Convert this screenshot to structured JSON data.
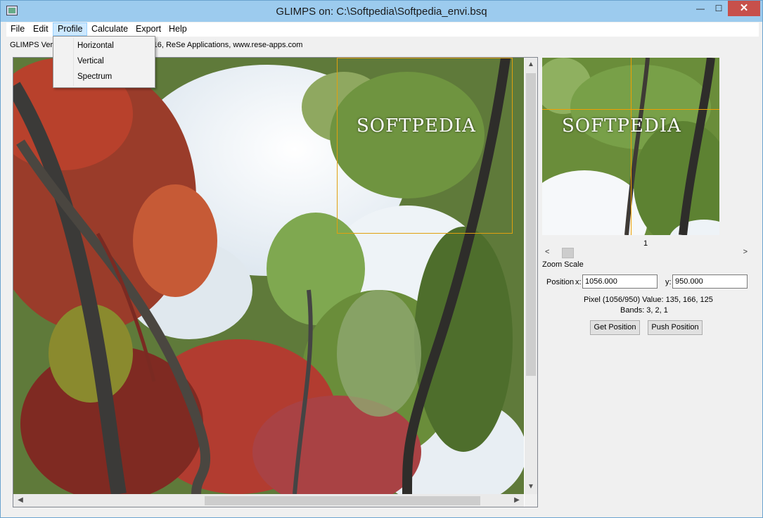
{
  "window": {
    "title": "GLIMPS on: C:\\Softpedia\\Softpedia_envi.bsq",
    "minimize_glyph": "—",
    "maximize_glyph": "☐",
    "close_glyph": "✕"
  },
  "menu": {
    "items": [
      "File",
      "Edit",
      "Profile",
      "Calculate",
      "Export",
      "Help"
    ],
    "active": "Profile"
  },
  "profile_dropdown": {
    "items": [
      "Horizontal",
      "Vertical",
      "Spectrum"
    ]
  },
  "info_line": {
    "left": "GLIMPS Ver",
    "right": "(c) DS 2016, ReSe Applications, www.rese-apps.com"
  },
  "watermark": "SOFTPEDIA",
  "zoom_panel": {
    "page_number": "1",
    "zoom_label": "Zoom Scale",
    "position_label": "Position",
    "x_label": "x:",
    "y_label": "y:",
    "x_value": "1056.000",
    "y_value": "950.000",
    "pixel_info": "Pixel (1056/950) Value: 135, 166, 125",
    "bands_info": "Bands:  3,  2,  1",
    "get_button": "Get Position",
    "push_button": "Push Position"
  },
  "scroll_arrows": {
    "up": "▲",
    "down": "▼",
    "left": "◀",
    "right": "▶"
  }
}
